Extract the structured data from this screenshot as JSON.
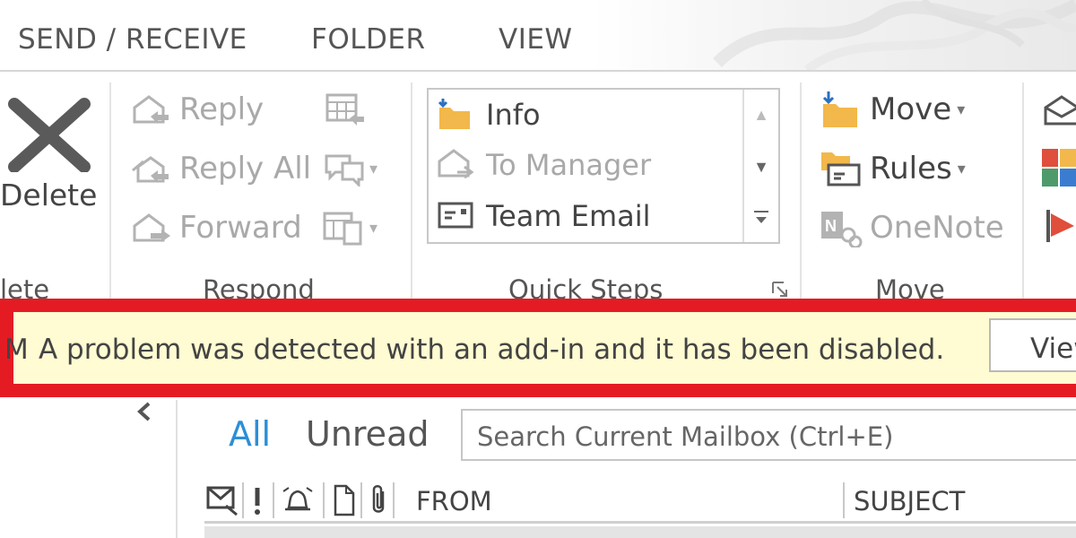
{
  "tabs": [
    "SEND / RECEIVE",
    "FOLDER",
    "VIEW"
  ],
  "delete_group": {
    "button_label": "Delete",
    "group_label": "lete"
  },
  "respond": {
    "reply": "Reply",
    "reply_all": "Reply All",
    "forward": "Forward",
    "group_label": "Respond"
  },
  "quick_steps": {
    "items": [
      "Info",
      "To Manager",
      "Team Email"
    ],
    "group_label": "Quick Steps"
  },
  "move_group": {
    "move": "Move",
    "rules": "Rules",
    "onenote": "OneNote",
    "group_label": "Move"
  },
  "message_bar": {
    "lead": "M",
    "text": "A problem was detected with an add-in and it has been disabled.",
    "button": "View"
  },
  "mail": {
    "filter_all": "All",
    "filter_unread": "Unread",
    "search_placeholder": "Search Current Mailbox (Ctrl+E)",
    "col_from": "FROM",
    "col_subject": "SUBJECT"
  },
  "icons": [
    "delete-x-icon",
    "reply-icon",
    "reply-all-icon",
    "forward-icon",
    "meeting-icon",
    "im-icon",
    "more-respond-icon",
    "folder-arrow-icon",
    "mail-icon",
    "team-email-icon",
    "move-folder-icon",
    "rules-icon",
    "onenote-icon",
    "envelope-icon",
    "categorize-icon",
    "flag-icon",
    "collapse-icon",
    "launcher-icon"
  ],
  "colors": {
    "alert_border": "#e51b24",
    "alert_bg": "#fffbd2",
    "accent": "#2b8fd6",
    "folder": "#f2b84b"
  }
}
